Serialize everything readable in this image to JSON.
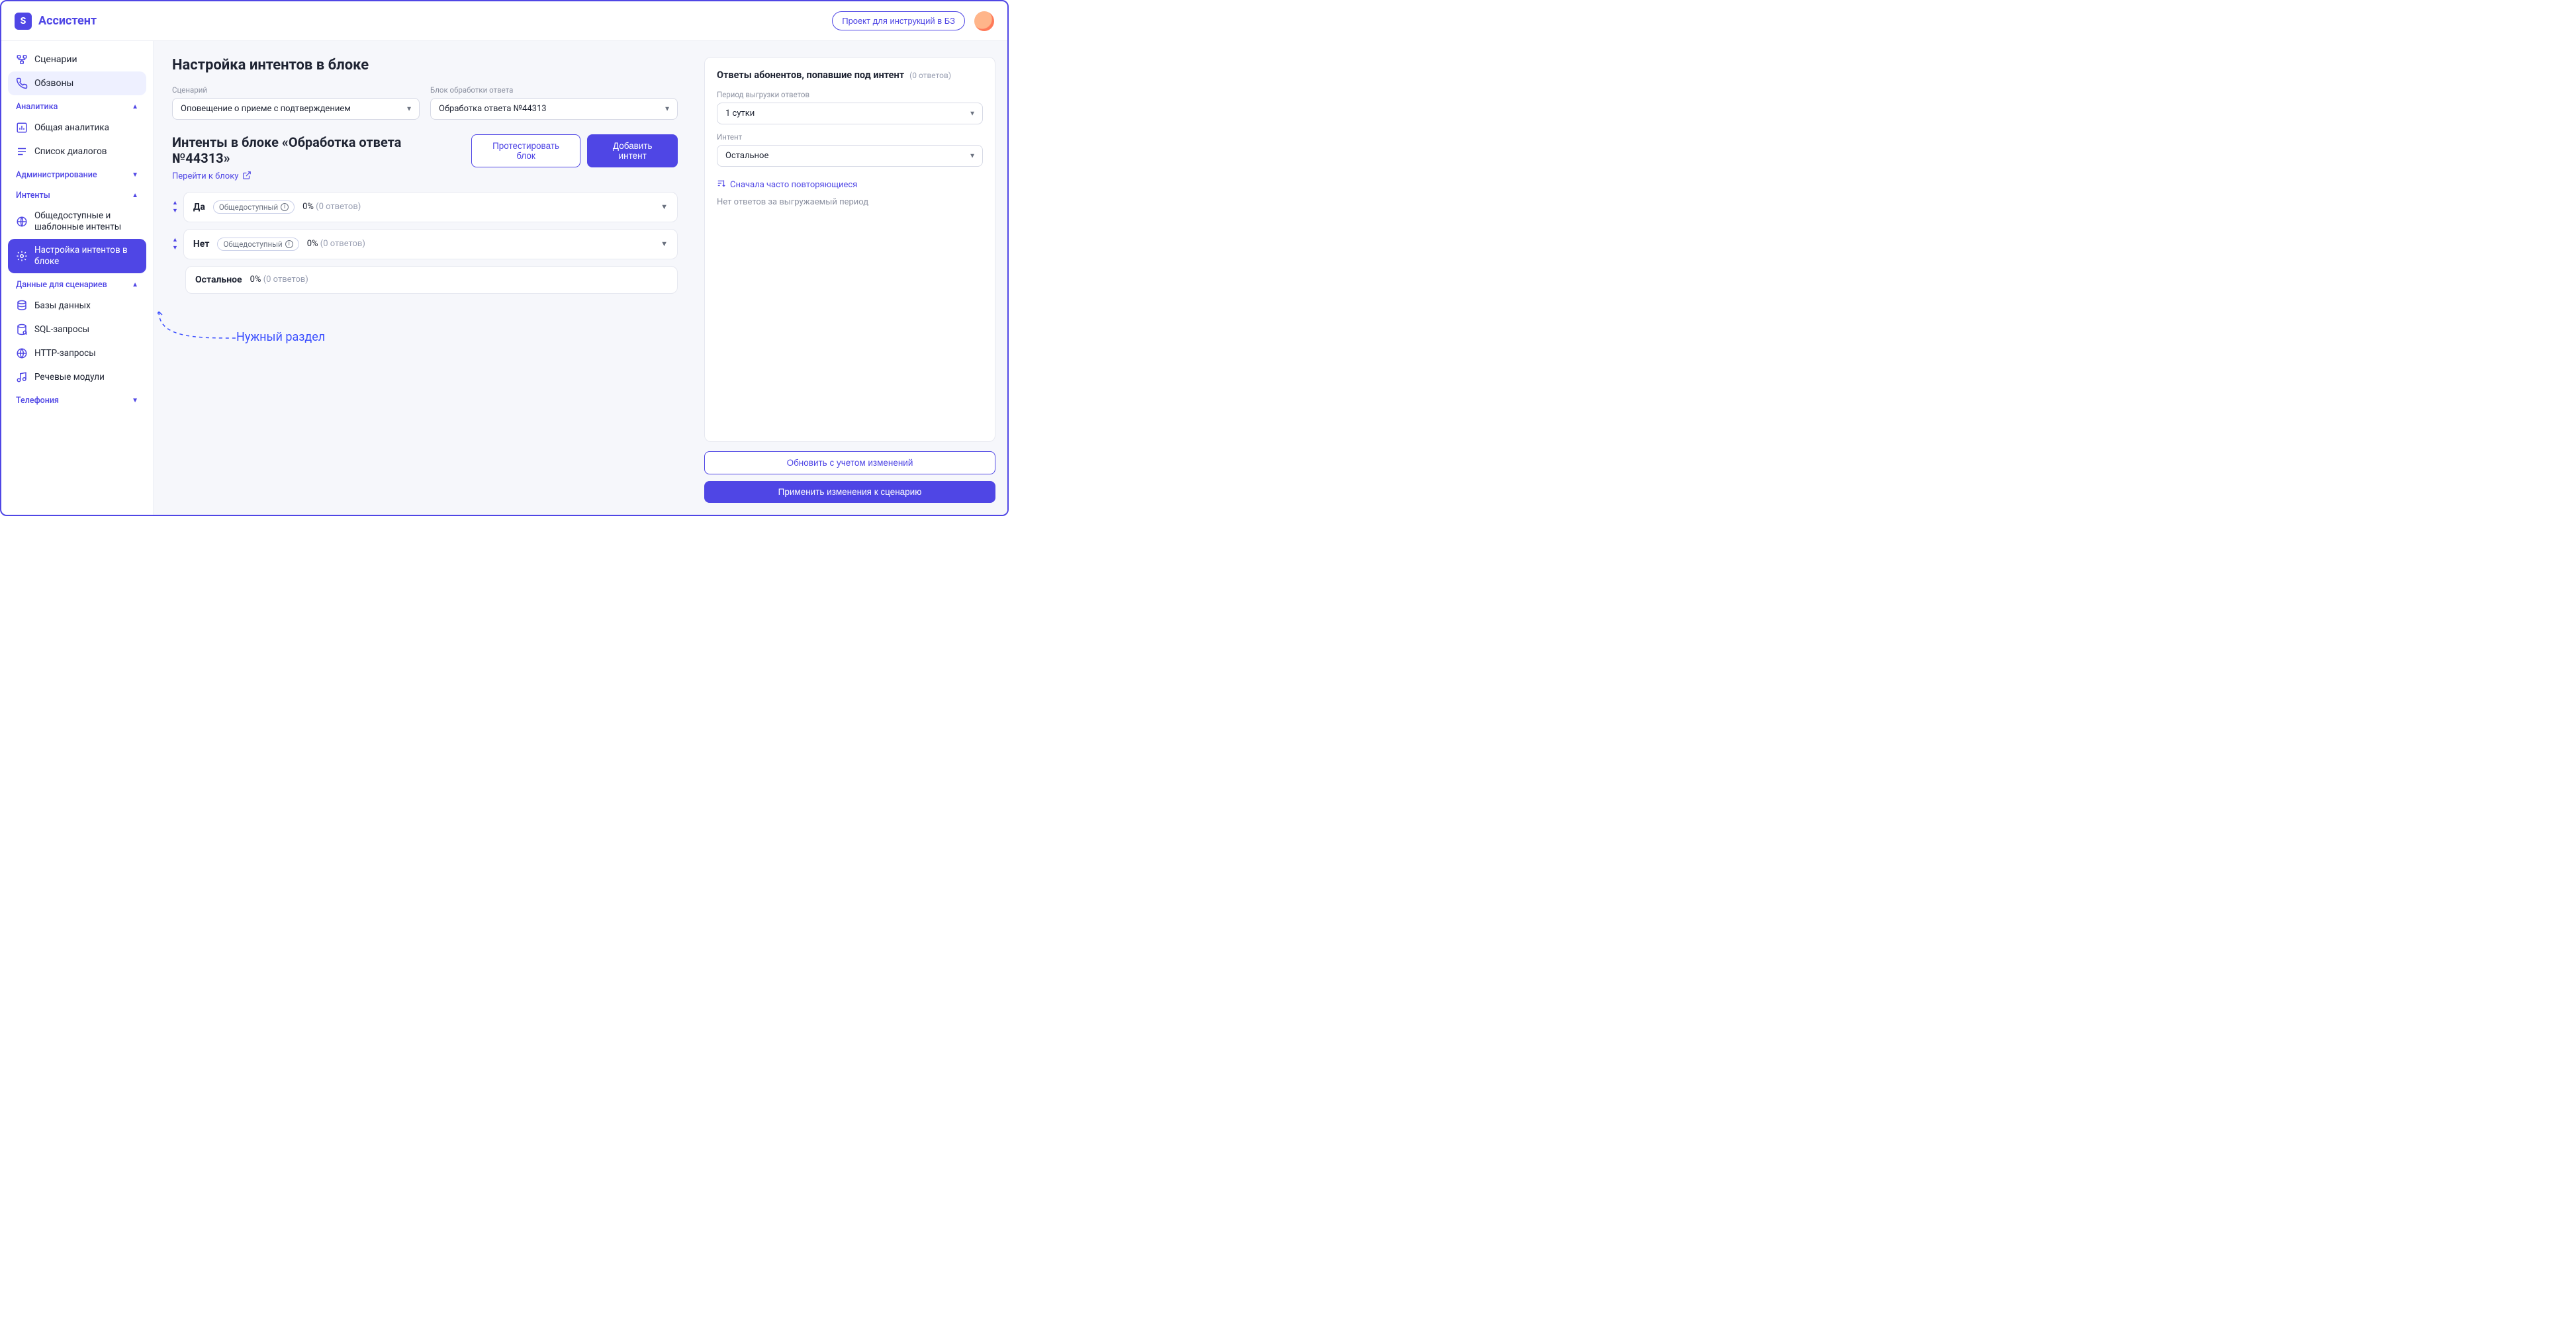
{
  "brand": "Ассистент",
  "header": {
    "project_button": "Проект для инструкций в БЗ"
  },
  "sidebar": {
    "top": [
      {
        "label": "Сценарии",
        "icon": "flow-icon"
      },
      {
        "label": "Обзвоны",
        "icon": "phone-icon",
        "active": true
      }
    ],
    "sections": [
      {
        "title": "Аналитика",
        "items": [
          {
            "label": "Общая аналитика",
            "icon": "chart-icon"
          },
          {
            "label": "Список диалогов",
            "icon": "dialog-list-icon"
          }
        ]
      },
      {
        "title": "Администрирование",
        "collapsed": true,
        "items": []
      },
      {
        "title": "Интенты",
        "items": [
          {
            "label": "Общедоступные и шаблонные интенты",
            "icon": "globe-gear-icon"
          },
          {
            "label": "Настройка интентов в блоке",
            "icon": "brain-gear-icon",
            "primary": true
          }
        ]
      },
      {
        "title": "Данные для сценариев",
        "items": [
          {
            "label": "Базы данных",
            "icon": "database-icon"
          },
          {
            "label": "SQL-запросы",
            "icon": "sql-icon"
          },
          {
            "label": "HTTP-запросы",
            "icon": "http-icon"
          },
          {
            "label": "Речевые модули",
            "icon": "speech-icon"
          }
        ]
      },
      {
        "title": "Телефония",
        "collapsed": true,
        "items": []
      }
    ]
  },
  "main": {
    "title": "Настройка интентов в блоке",
    "scenario_label": "Сценарий",
    "scenario_value": "Оповещение о приеме с подтверждением",
    "block_label": "Блок обработки ответа",
    "block_value": "Обработка ответа №44313",
    "intents_heading": "Интенты в блоке «Обработка ответа №44313»",
    "go_to_block": "Перейти к блоку",
    "test_button": "Протестировать блок",
    "add_button": "Добавить интент",
    "tag_public": "Общедоступный",
    "intents": [
      {
        "name": "Да",
        "tagged": true,
        "percent": "0%",
        "answers": "(0 ответов)",
        "expandable": true
      },
      {
        "name": "Нет",
        "tagged": true,
        "percent": "0%",
        "answers": "(0 ответов)",
        "expandable": true
      },
      {
        "name": "Остальное",
        "tagged": false,
        "percent": "0%",
        "answers": "(0 ответов)",
        "expandable": false
      }
    ]
  },
  "annotation": "Нужный раздел",
  "right": {
    "title": "Ответы абонентов, попавшие под интент",
    "count": "(0 ответов)",
    "period_label": "Период выгрузки ответов",
    "period_value": "1 сутки",
    "intent_label": "Интент",
    "intent_value": "Остальное",
    "sort_label": "Сначала часто повторяющиеся",
    "empty": "Нет ответов за выгружаемый период",
    "refresh_button": "Обновить с учетом изменений",
    "apply_button": "Применить изменения к сценарию"
  }
}
